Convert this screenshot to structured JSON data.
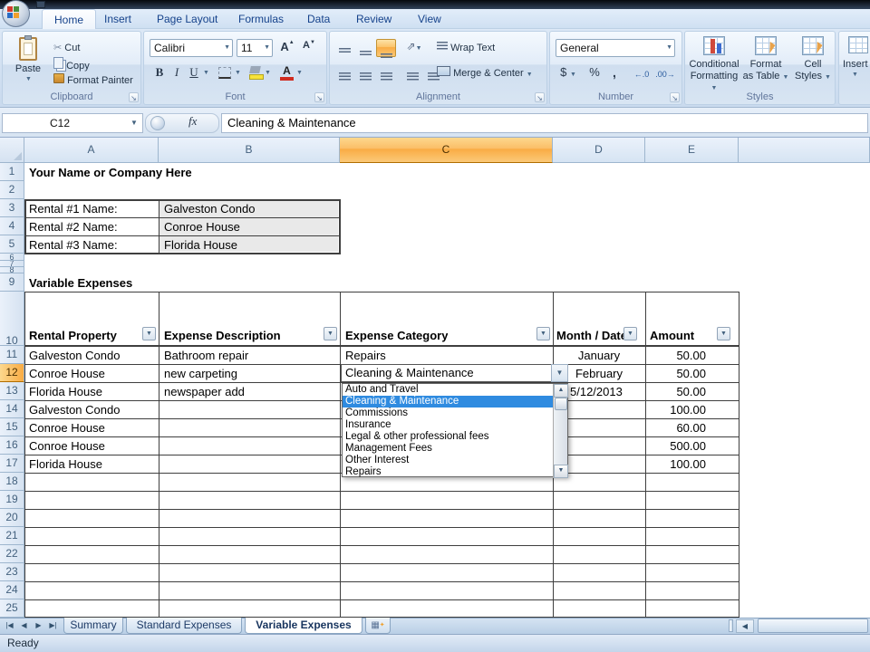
{
  "ribbon": {
    "tabs": [
      "Home",
      "Insert",
      "Page Layout",
      "Formulas",
      "Data",
      "Review",
      "View"
    ],
    "groups": {
      "clipboard": {
        "label": "Clipboard",
        "paste": "Paste",
        "cut": "Cut",
        "copy": "Copy",
        "format_painter": "Format Painter"
      },
      "font": {
        "label": "Font",
        "family": "Calibri",
        "size": "11",
        "bold": "B",
        "italic": "I",
        "underline": "U"
      },
      "alignment": {
        "label": "Alignment",
        "wrap_text": "Wrap Text",
        "merge_center": "Merge & Center"
      },
      "number": {
        "label": "Number",
        "format": "General",
        "currency": "$",
        "percent": "%",
        "comma": ","
      },
      "styles": {
        "label": "Styles",
        "conditional_1": "Conditional",
        "conditional_2": "Formatting",
        "format_1": "Format",
        "format_2": "as Table",
        "cell_1": "Cell",
        "cell_2": "Styles"
      },
      "cells": {
        "insert": "Insert"
      }
    }
  },
  "formula_bar": {
    "name_box": "C12",
    "fx": "fx",
    "content": "Cleaning & Maintenance"
  },
  "sheet": {
    "column_headers": [
      "A",
      "B",
      "C",
      "D",
      "E"
    ],
    "row_numbers": [
      "1",
      "2",
      "3",
      "4",
      "5",
      "6",
      "7",
      "8",
      "9",
      "10",
      "11",
      "12",
      "13",
      "14",
      "15",
      "16",
      "17",
      "18",
      "19",
      "20",
      "21",
      "22",
      "23",
      "24",
      "25"
    ],
    "a1": "Your Name or Company Here",
    "rental_labels": [
      "Rental #1 Name:",
      "Rental #2 Name:",
      "Rental #3 Name:"
    ],
    "rental_values": [
      "Galveston Condo",
      "Conroe House",
      "Florida House"
    ],
    "section_title": "Variable Expenses",
    "headers": [
      "Rental Property",
      "Expense Description",
      "Expense Category",
      "Month / Date",
      "Amount"
    ],
    "rows": [
      {
        "property": "Galveston Condo",
        "description": "Bathroom repair",
        "category": "Repairs",
        "month": "January",
        "amount": "50.00"
      },
      {
        "property": "Conroe House",
        "description": "new carpeting",
        "category": "Cleaning & Maintenance",
        "month": "February",
        "amount": "50.00"
      },
      {
        "property": "Florida House",
        "description": "newspaper add",
        "category": "",
        "month": "5/12/2013",
        "amount": "50.00"
      },
      {
        "property": "Galveston Condo",
        "description": "",
        "category": "",
        "month": "",
        "amount": "100.00"
      },
      {
        "property": "Conroe House",
        "description": "",
        "category": "",
        "month": "",
        "amount": "60.00"
      },
      {
        "property": "Conroe House",
        "description": "",
        "category": "",
        "month": "",
        "amount": "500.00"
      },
      {
        "property": "Florida House",
        "description": "",
        "category": "",
        "month": "",
        "amount": "100.00"
      }
    ],
    "dropdown": {
      "value": "Cleaning & Maintenance",
      "items": [
        "Auto and Travel",
        "Cleaning & Maintenance",
        "Commissions",
        "Insurance",
        "Legal & other professional fees",
        "Management Fees",
        "Other Interest",
        "Repairs"
      ],
      "selected_index": 1
    }
  },
  "sheet_tabs": [
    "Summary",
    "Standard Expenses",
    "Variable Expenses"
  ],
  "status_bar": {
    "ready": "Ready"
  },
  "colors": {
    "selection_orange": "#F9AB43",
    "dropdown_highlight": "#2F8BE0",
    "table_border": "#3F3F3F"
  }
}
